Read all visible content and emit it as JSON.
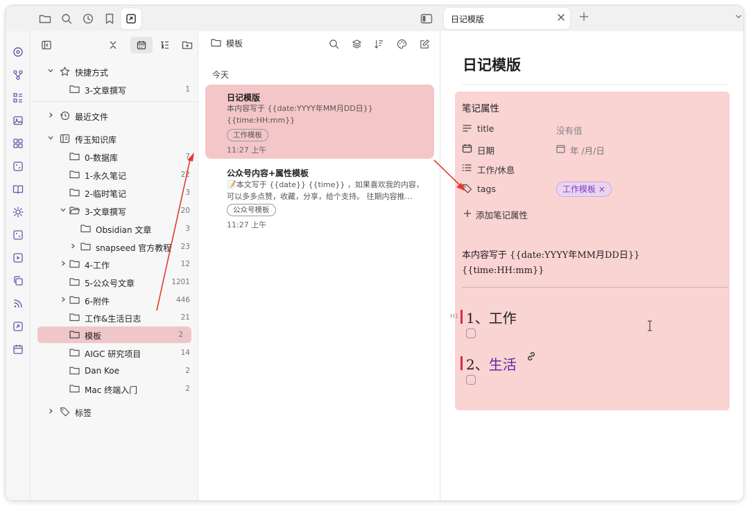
{
  "colors": {
    "accent_red": "#e23a2e",
    "selected_row": "#efc7c9",
    "selected_card": "#f4c6c8",
    "props_bg": "#fad3d3",
    "tag_purple": "#7c3fc4",
    "heading_bar": "#d22f43"
  },
  "topbar": {
    "icons": [
      "folder-icon",
      "search-icon",
      "clock-icon",
      "bookmark-icon",
      "template-icon"
    ],
    "tab": {
      "title": "日记模版"
    },
    "icons_right": [
      "sidebar-toggle-icon",
      "close-icon",
      "plus-icon",
      "chevron-down-icon"
    ]
  },
  "ribbon": {
    "icons": [
      "graph-view-icon",
      "branch-icon",
      "layout-icon",
      "image-icon",
      "canvas-icon",
      "dots-icon",
      "book-icon",
      "sun-icon",
      "dots2-icon",
      "video-icon",
      "copy-icon",
      "rss-icon",
      "template-icon",
      "calendar-icon"
    ]
  },
  "sidebar": {
    "toolbar": [
      "collapse-sidebar-icon",
      "collapse-all-icon",
      "calendar-icon",
      "tree-icon",
      "new-folder-icon"
    ],
    "shortcuts": {
      "label": "快捷方式",
      "item": {
        "label": "3-文章撰写",
        "count": "1"
      }
    },
    "recent": {
      "label": "最近文件"
    },
    "vault": {
      "label": "传玉知识库"
    },
    "folders": [
      {
        "label": "0-数据库",
        "count": "7"
      },
      {
        "label": "1-永久笔记",
        "count": "22"
      },
      {
        "label": "2-临时笔记",
        "count": "3"
      },
      {
        "label": "3-文章撰写",
        "count": "20"
      },
      {
        "label": "Obsidian 文章",
        "count": "3"
      },
      {
        "label": "snapseed 官方教程",
        "count": "23"
      },
      {
        "label": "4-工作",
        "count": "12"
      },
      {
        "label": "5-公众号文章",
        "count": "1201"
      },
      {
        "label": "6-附件",
        "count": "446"
      },
      {
        "label": "工作&生活日志",
        "count": "21"
      },
      {
        "label": "模板",
        "count": "2"
      },
      {
        "label": "AIGC 研究项目",
        "count": "14"
      },
      {
        "label": "Dan Koe",
        "count": "2"
      },
      {
        "label": "Mac 终端入门",
        "count": "2"
      }
    ],
    "tags": {
      "label": "标签"
    }
  },
  "notes_list": {
    "folder_label": "模板",
    "section": "今天",
    "cards": [
      {
        "title": "日记模版",
        "body": "本内容写于 {{date:YYYY年MM月DD日}} {{time:HH:mm}}",
        "tag": "工作模板",
        "time": "11:27 上午"
      },
      {
        "title": "公众号内容+属性模板",
        "body": "📝本文写于 {{date}} {{time}} ，如果喜欢我的内容，可以多多点赞，收藏，分享，给个支持。 往期内容推…",
        "tag": "公众号模板",
        "time": "11:27 上午"
      }
    ]
  },
  "editor": {
    "title": "日记模版",
    "properties_header": "笔记属性",
    "properties": [
      {
        "name": "title",
        "value": "没有值"
      },
      {
        "name": "日期",
        "value": "年 /月/日"
      },
      {
        "name": "工作/休息",
        "value": ""
      },
      {
        "name": "tags",
        "value": "工作模板 ×"
      }
    ],
    "add_property": "添加笔记属性",
    "content_line1": "本内容写于 {{date:YYYY年MM月DD日}}",
    "content_line2": "{{time:HH:mm}}",
    "h1_marker": "H1",
    "heading1": "1、工作",
    "heading2_prefix": "2、",
    "heading2_link": "生活"
  }
}
